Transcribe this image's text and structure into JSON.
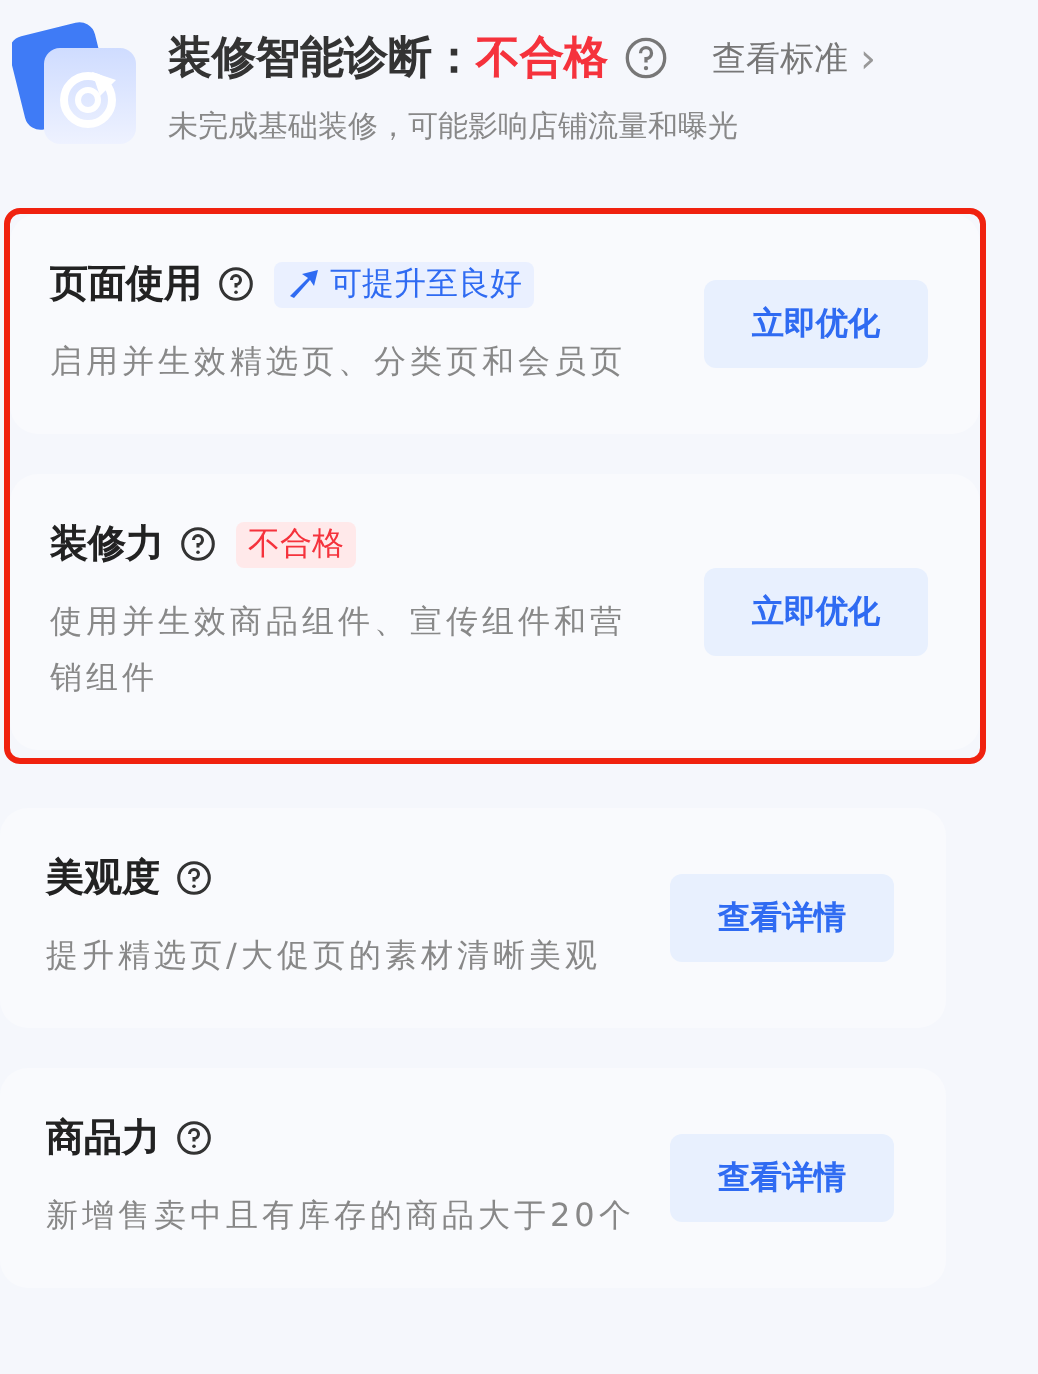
{
  "header": {
    "title": "装修智能诊断：",
    "status": "不合格",
    "standard_link": "查看标准",
    "chevron": "›",
    "subtitle": "未完成基础装修，可能影响店铺流量和曝光"
  },
  "sections": [
    {
      "highlighted": true,
      "items": [
        {
          "title": "页面使用",
          "badge": {
            "kind": "improve",
            "text": "可提升至良好"
          },
          "description": "启用并生效精选页、分类页和会员页",
          "button": "立即优化"
        },
        {
          "title": "装修力",
          "badge": {
            "kind": "fail",
            "text": "不合格"
          },
          "description": "使用并生效商品组件、宣传组件和营销组件",
          "button": "立即优化"
        }
      ]
    },
    {
      "highlighted": false,
      "items": [
        {
          "title": "美观度",
          "description": "提升精选页/大促页的素材清晰美观",
          "button": "查看详情"
        },
        {
          "title": "商品力",
          "description": "新增售卖中且有库存的商品大于20个",
          "button": "查看详情"
        }
      ]
    }
  ]
}
